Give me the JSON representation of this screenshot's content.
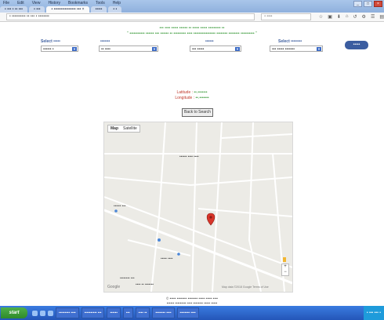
{
  "browser": {
    "menu": [
      "File",
      "Edit",
      "View",
      "History",
      "Bookmarks",
      "Tools",
      "Help"
    ],
    "window_buttons": [
      "_",
      "□",
      "×"
    ],
    "tabs": [
      "•  ••• •  •• •••",
      "•  •••",
      "• •••••••••••••••• ••• ×",
      "•••••",
      "•  •"
    ],
    "active_tab": 2,
    "address": "• ••••••••••  •• ••• • ••••••••",
    "search_placeholder": "•  ••••",
    "tool_icons": [
      "☆",
      "▣",
      "⬇",
      "⌂",
      "↺",
      "⚙",
      "☰",
      "▤"
    ]
  },
  "page": {
    "notice_line1": "••• •••• ••••• •••••• •• ••••• ••••• ••••••••• ••",
    "notice_line2": "\" ••••••••••• •••••• ••• •••••• •• ••••••••• •••• •••••••••••••••• •••••••• •••••••• •••••••••• \"",
    "filters": [
      {
        "label": "Select •••••",
        "value": "•••••• •"
      },
      {
        "label": "•••••••",
        "value": "•• ••••"
      },
      {
        "label": "••••••",
        "value": "••• •••••"
      },
      {
        "label": "Select ••••••••",
        "value": "••• ••••• •••••••"
      }
    ],
    "go_button": "•••••",
    "latitude_label": "Latitude :",
    "latitude_value": "••.•••••••",
    "longitude_label": "Longitude :",
    "longitude_value": "••.•••••••",
    "back_button": "Back to Search",
    "map": {
      "view_options": [
        "Map",
        "Satellite"
      ],
      "labels": [
        "•••••• •••• ••••",
        "•••••• •••",
        "••••• ••••",
        "•••••••• •••",
        "•••• •• •••••••"
      ],
      "google": "Google",
      "terms": "Map data ©2018 Google  Terms of Use",
      "zoom_in": "+",
      "zoom_out": "−"
    },
    "footer_line1": "© ••••• •••••••• •••••••• ••••• ••••• ••••",
    "footer_line2": "•••••• ••••••••• •••• •••••••• ••••• •••••"
  },
  "taskbar": {
    "start": "start",
    "tasks": [
      "••••••••• ••••",
      "•••••••••• •••",
      "••••••",
      "•••",
      "•••• ••",
      "•••••••• ••••",
      "•••••••• ••••"
    ],
    "tray": "• ••• ••• •"
  },
  "colors": {
    "accent_blue": "#3b5da0",
    "notice_green": "#3a9a3a",
    "label_red": "#c0392b",
    "marker_red": "#d8352a"
  }
}
